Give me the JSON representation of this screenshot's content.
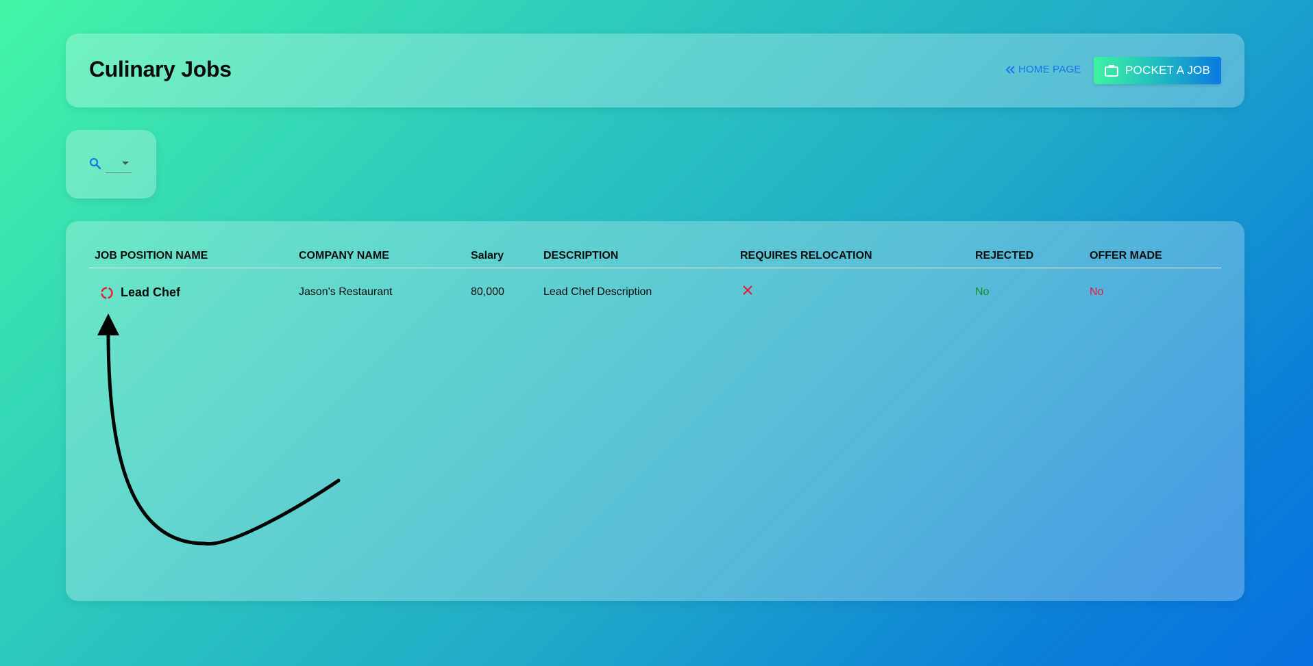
{
  "header": {
    "title": "Culinary Jobs",
    "home_link": "HOME PAGE",
    "pocket_button": "POCKET A JOB"
  },
  "search": {
    "icon": "search-icon",
    "filter_value": ""
  },
  "table": {
    "columns": [
      "JOB POSITION NAME",
      "COMPANY NAME",
      "Salary",
      "DESCRIPTION",
      "REQUIRES RELOCATION",
      "REJECTED",
      "OFFER MADE"
    ],
    "rows": [
      {
        "position": "Lead Chef",
        "company": "Jason's Restaurant",
        "salary": "80,000",
        "description": "Lead Chef Description",
        "requires_relocation_icon": "x-icon",
        "rejected": "No",
        "offer_made": "No"
      }
    ]
  },
  "colors": {
    "accent_blue": "#1a73e8",
    "rejected_no": "#1b8a2a",
    "offer_no": "#e8163a",
    "status_ring": "#e0283a",
    "relocation_x": "#e8163a"
  }
}
